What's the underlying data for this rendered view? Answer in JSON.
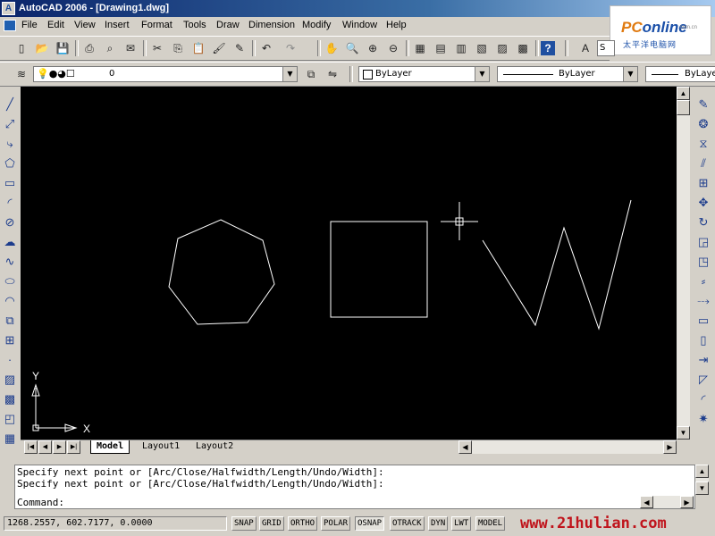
{
  "window": {
    "title": "AutoCAD 2006 - [Drawing1.dwg]"
  },
  "logo": {
    "brand_a": "PC",
    "brand_b": "online",
    "sub": "太平洋电脑网",
    "domain": ".com.cn"
  },
  "menu": [
    "File",
    "Edit",
    "View",
    "Insert",
    "Format",
    "Tools",
    "Draw",
    "Dimension",
    "Modify",
    "Window",
    "Help"
  ],
  "toolbar_properties": {
    "layer_value": "0",
    "color": "ByLayer",
    "linetype": "ByLayer",
    "lineweight": "ByLayer"
  },
  "text_style_value": "S",
  "ucs": {
    "y_label": "Y",
    "x_label": "X"
  },
  "tabs": {
    "model": "Model",
    "layout1": "Layout1",
    "layout2": "Layout2"
  },
  "command": {
    "lines": [
      "Specify next point or [Arc/Close/Halfwidth/Length/Undo/Width]:",
      "Specify next point or [Arc/Close/Halfwidth/Length/Undo/Width]:"
    ],
    "prompt": "Command:"
  },
  "status": {
    "coordinates": "1268.2557, 602.7177, 0.0000",
    "buttons": [
      {
        "label": "SNAP",
        "on": false
      },
      {
        "label": "GRID",
        "on": false
      },
      {
        "label": "ORTHO",
        "on": false
      },
      {
        "label": "POLAR",
        "on": false
      },
      {
        "label": "OSNAP",
        "on": true
      },
      {
        "label": "OTRACK",
        "on": false
      },
      {
        "label": "DYN",
        "on": false
      },
      {
        "label": "LWT",
        "on": false
      },
      {
        "label": "MODEL",
        "on": false
      }
    ],
    "watermark": "www.21hulian.com"
  },
  "colors": {
    "canvas": "#000000",
    "geometry": "#ffffff",
    "chrome": "#d4d0c8",
    "watermark": "#c0141c"
  }
}
